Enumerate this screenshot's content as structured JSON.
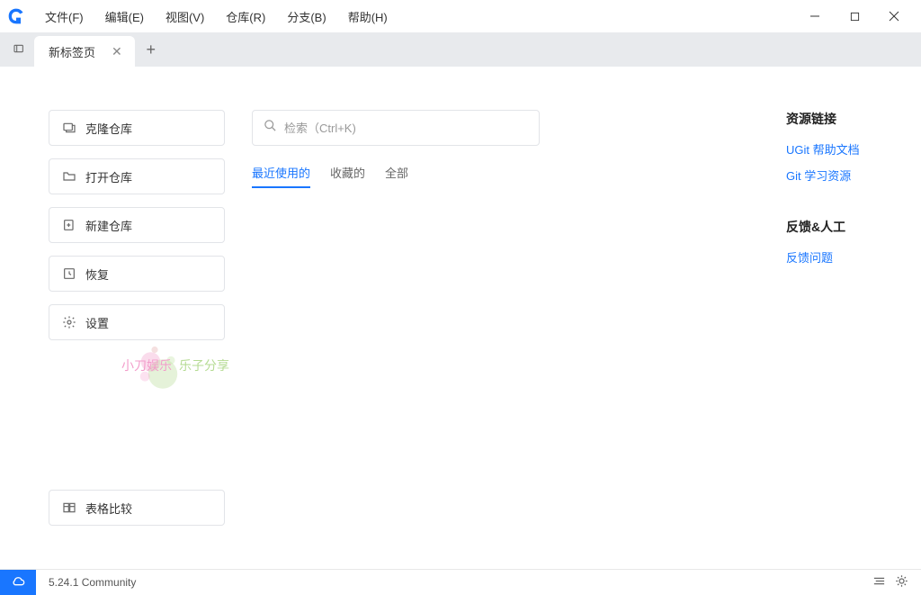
{
  "menu": {
    "items": [
      "文件(F)",
      "编辑(E)",
      "视图(V)",
      "仓库(R)",
      "分支(B)",
      "帮助(H)"
    ]
  },
  "tab": {
    "label": "新标签页"
  },
  "actions": {
    "clone": "克隆仓库",
    "open": "打开仓库",
    "new": "新建仓库",
    "restore": "恢复",
    "settings": "设置",
    "compare": "表格比较"
  },
  "search": {
    "placeholder": "检索（Ctrl+K)"
  },
  "filters": {
    "recent": "最近使用的",
    "favorites": "收藏的",
    "all": "全部"
  },
  "right": {
    "resources_title": "资源链接",
    "help_doc": "UGit 帮助文档",
    "git_learn": "Git 学习资源",
    "feedback_title": "反馈&人工",
    "feedback_link": "反馈问题"
  },
  "watermark": {
    "a": "小刀娱乐",
    "b": "乐子分享"
  },
  "status": {
    "version": "5.24.1 Community"
  }
}
